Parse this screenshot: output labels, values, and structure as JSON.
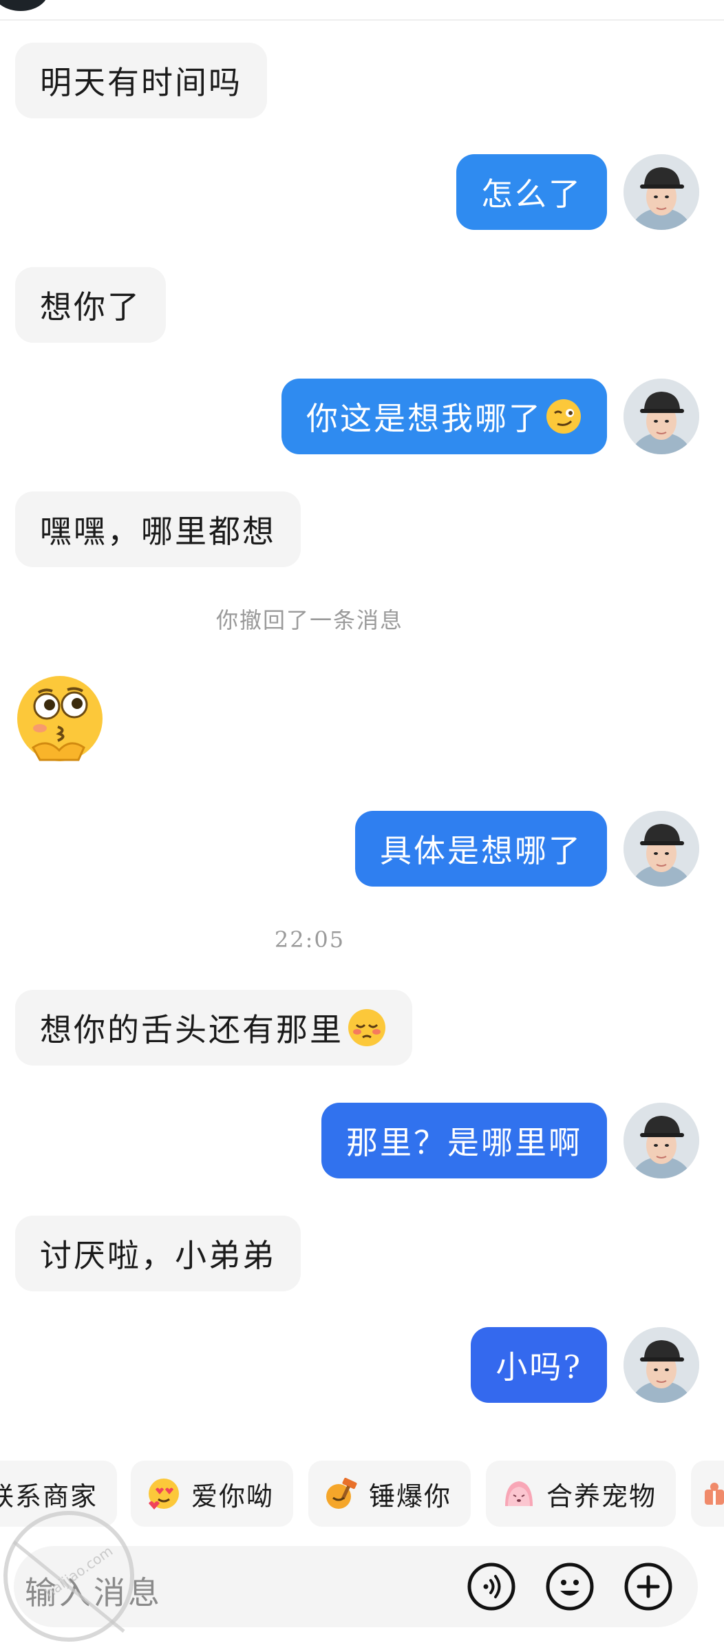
{
  "messages": [
    {
      "side": "left",
      "text": "明天有时间吗"
    },
    {
      "side": "right",
      "text": "怎么了"
    },
    {
      "side": "left",
      "text": "想你了"
    },
    {
      "side": "right",
      "text": "你这是想我哪了"
    },
    {
      "side": "left",
      "text": "嘿嘿，哪里都想"
    },
    {
      "side": "right",
      "text": "具体是想哪了"
    },
    {
      "side": "left",
      "text": "想你的舌头还有那里"
    },
    {
      "side": "right",
      "text": "那里？是哪里啊"
    },
    {
      "side": "left",
      "text": "讨厌啦，小弟弟"
    },
    {
      "side": "right",
      "text": "小吗?"
    }
  ],
  "notice_recall": "你撤回了一条消息",
  "timestamp": "22:05",
  "shortcuts": [
    {
      "label": "联系商家",
      "icon": "store-icon"
    },
    {
      "label": "爱你呦",
      "icon": "heart-eyes-icon"
    },
    {
      "label": "锤爆你",
      "icon": "hammer-icon"
    },
    {
      "label": "合养宠物",
      "icon": "pet-icon"
    }
  ],
  "input": {
    "placeholder": "输入消息"
  },
  "watermark": "haijiao.com",
  "colors": {
    "bubble_left": "#f4f4f4",
    "bubble_right": "#2f7ff0"
  }
}
